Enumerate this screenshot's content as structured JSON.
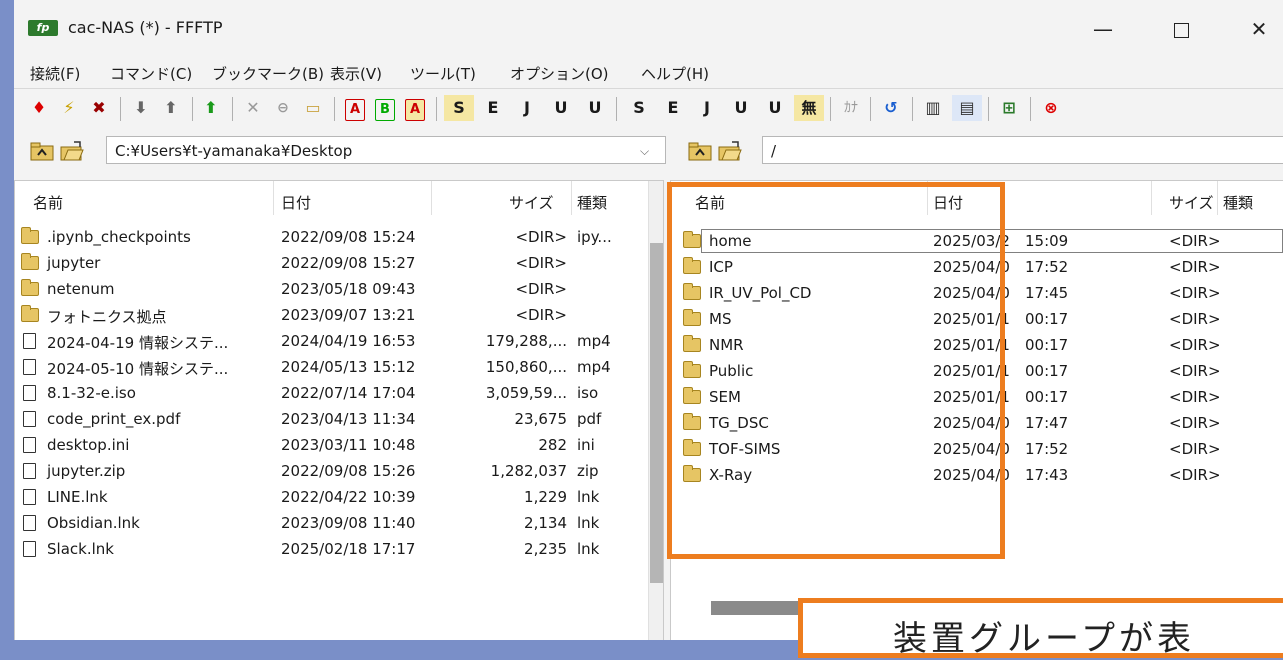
{
  "window": {
    "title": "cac-NAS (*) - FFFTP",
    "app_icon_text": "fp",
    "min_glyph": "—",
    "close_glyph": "✕"
  },
  "menu": [
    "接続(F)",
    "コマンド(C)",
    "ブックマーク(B)",
    "表示(V)",
    "ツール(T)",
    "オプション(O)",
    "ヘルプ(H)"
  ],
  "toolbar": {
    "ascii_label": "A",
    "binary_label": "B",
    "auto_label": "A",
    "kanji_sjis": "S",
    "kanji_euc": "E",
    "kanji_jis": "J",
    "kanji_utf": "U",
    "kanji_utfb": "U",
    "kanji_none": "無",
    "kana_label": "ｶﾅ"
  },
  "left_path": "C:¥Users¥t-yamanaka¥Desktop",
  "right_path": "/",
  "headers": {
    "name": "名前",
    "date": "日付",
    "size": "サイズ",
    "type": "種類"
  },
  "local_files": [
    {
      "name": ".ipynb_checkpoints",
      "date": "2022/09/08 15:24",
      "size": "<DIR>",
      "type": "ipy...",
      "kind": "folder"
    },
    {
      "name": "jupyter",
      "date": "2022/09/08 15:27",
      "size": "<DIR>",
      "type": "",
      "kind": "folder"
    },
    {
      "name": "netenum",
      "date": "2023/05/18 09:43",
      "size": "<DIR>",
      "type": "",
      "kind": "folder"
    },
    {
      "name": "フォトニクス拠点",
      "date": "2023/09/07 13:21",
      "size": "<DIR>",
      "type": "",
      "kind": "folder"
    },
    {
      "name": "2024-04-19 情報システ...",
      "date": "2024/04/19 16:53",
      "size": "179,288,...",
      "type": "mp4",
      "kind": "file"
    },
    {
      "name": "2024-05-10 情報システ...",
      "date": "2024/05/13 15:12",
      "size": "150,860,...",
      "type": "mp4",
      "kind": "file"
    },
    {
      "name": "8.1-32-e.iso",
      "date": "2022/07/14 17:04",
      "size": "3,059,59...",
      "type": "iso",
      "kind": "file"
    },
    {
      "name": "code_print_ex.pdf",
      "date": "2023/04/13 11:34",
      "size": "23,675",
      "type": "pdf",
      "kind": "file"
    },
    {
      "name": "desktop.ini",
      "date": "2023/03/11 10:48",
      "size": "282",
      "type": "ini",
      "kind": "file"
    },
    {
      "name": "jupyter.zip",
      "date": "2022/09/08 15:26",
      "size": "1,282,037",
      "type": "zip",
      "kind": "file"
    },
    {
      "name": "LINE.lnk",
      "date": "2022/04/22 10:39",
      "size": "1,229",
      "type": "lnk",
      "kind": "file"
    },
    {
      "name": "Obsidian.lnk",
      "date": "2023/09/08 11:40",
      "size": "2,134",
      "type": "lnk",
      "kind": "file"
    },
    {
      "name": "Slack.lnk",
      "date": "2025/02/18 17:17",
      "size": "2,235",
      "type": "lnk",
      "kind": "file"
    }
  ],
  "remote_files": [
    {
      "name": "home",
      "date": "2025/03/2",
      "time": "15:09",
      "size": "<DIR>"
    },
    {
      "name": "ICP",
      "date": "2025/04/0",
      "time": "17:52",
      "size": "<DIR>"
    },
    {
      "name": "IR_UV_Pol_CD",
      "date": "2025/04/0",
      "time": "17:45",
      "size": "<DIR>"
    },
    {
      "name": "MS",
      "date": "2025/01/1",
      "time": "00:17",
      "size": "<DIR>"
    },
    {
      "name": "NMR",
      "date": "2025/01/1",
      "time": "00:17",
      "size": "<DIR>"
    },
    {
      "name": "Public",
      "date": "2025/01/1",
      "time": "00:17",
      "size": "<DIR>"
    },
    {
      "name": "SEM",
      "date": "2025/01/1",
      "time": "00:17",
      "size": "<DIR>"
    },
    {
      "name": "TG_DSC",
      "date": "2025/04/0",
      "time": "17:47",
      "size": "<DIR>"
    },
    {
      "name": "TOF-SIMS",
      "date": "2025/04/0",
      "time": "17:52",
      "size": "<DIR>"
    },
    {
      "name": "X-Ray",
      "date": "2025/04/0",
      "time": "17:43",
      "size": "<DIR>"
    }
  ],
  "callout_text": "装置グループが表",
  "highlight_color": "#ed7d1f"
}
